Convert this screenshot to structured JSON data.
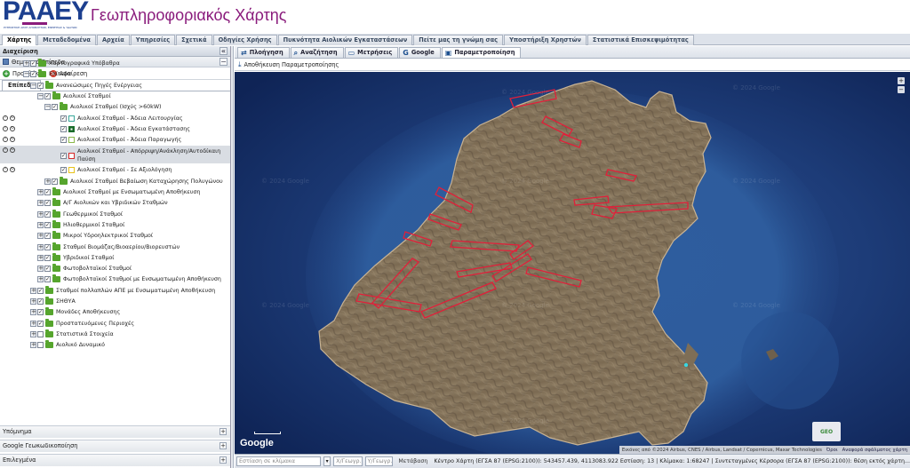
{
  "header": {
    "logo_text": "ΡΑΑΕΥ",
    "logo_subtitle": "ΡΥΘΜΙΣΤΙΚΗ ΑΡΧΗ ΑΠΟΒΛΗΤΩΝ, ΕΝΕΡΓΕΙΑΣ & ΥΔΑΤΩΝ",
    "app_title": "Γεωπληροφοριακός Χάρτης"
  },
  "main_tabs": [
    "Χάρτης",
    "Μεταδεδομένα",
    "Αρχεία",
    "Υπηρεσίες",
    "Σχετικά",
    "Οδηγίες Χρήσης",
    "Πυκνότητα Αιολικών Εγκαταστάσεων",
    "Πείτε μας τη γνώμη σας",
    "Υποστήριξη Χρηστών",
    "Στατιστικά Επισκεψιμότητας"
  ],
  "left_panel": {
    "title": "Διαχείριση",
    "section": "Θεματικά Επίπεδα",
    "add_label": "Προσθήκη",
    "remove_label": "Αφαίρεση",
    "tab": "Επίπεδα",
    "tree": [
      {
        "label": "Χαρτογραφικά Υπόβαθρα",
        "level": 2,
        "type": "folder",
        "checked": true,
        "exp": "+"
      },
      {
        "label": "Επίπεδα",
        "level": 2,
        "type": "folder",
        "checked": true,
        "exp": "−"
      },
      {
        "label": "Ανανεώσιμες Πηγές Ενέργειας",
        "level": 3,
        "type": "folder",
        "checked": true,
        "exp": "−"
      },
      {
        "label": "Αιολικοί Σταθμοί",
        "level": 4,
        "type": "folder",
        "checked": true,
        "exp": "−"
      },
      {
        "label": "Αιολικοί Σταθμοί (Ισχύς >60kW)",
        "level": 5,
        "type": "folder",
        "checked": true,
        "exp": "−"
      },
      {
        "label": "Αιολικοί Σταθμοί - Άδεια Λειτουργίας",
        "level": 6,
        "type": "layer",
        "checked": true,
        "legend": "#3aa89a",
        "info": true
      },
      {
        "label": "Αιολικοί Σταθμοί - Άδεια Εγκατάστασης",
        "level": 6,
        "type": "layer",
        "checked": true,
        "legend": "#1a6b2a",
        "legend_fill": true,
        "info": true
      },
      {
        "label": "Αιολικοί Σταθμοί - Άδεια Παραγωγής",
        "level": 6,
        "type": "layer",
        "checked": true,
        "legend": "#8ab84a",
        "info": true
      },
      {
        "label": "Αιολικοί Σταθμοί - Απόρριψη/Ανάκληση/Αυτοδίκαιη Παύση",
        "level": 6,
        "type": "layer",
        "checked": true,
        "legend": "#d62a2a",
        "info": true,
        "selected": true
      },
      {
        "label": "Αιολικοί Σταθμοί - Σε Αξιολόγηση",
        "level": 6,
        "type": "layer",
        "checked": true,
        "legend": "#e8c21a",
        "info": true
      },
      {
        "label": "Αιολικοί Σταθμοί Βεβαίωση Καταχώρησης Πολυγώνου",
        "level": 5,
        "type": "folder",
        "checked": true,
        "exp": "+"
      },
      {
        "label": "Αιολικοί Σταθμοί με Ενσωματωμένη Αποθήκευση",
        "level": 4,
        "type": "folder",
        "checked": true,
        "exp": "+"
      },
      {
        "label": "Α/Γ Αιολικών και Υβριδικών Σταθμών",
        "level": 4,
        "type": "folder",
        "checked": true,
        "exp": "+"
      },
      {
        "label": "Γεωθερμικοί Σταθμοί",
        "level": 4,
        "type": "folder",
        "checked": true,
        "exp": "+"
      },
      {
        "label": "Ηλιοθερμικοί Σταθμοί",
        "level": 4,
        "type": "folder",
        "checked": true,
        "exp": "+"
      },
      {
        "label": "Μικροί Υδροηλεκτρικοί Σταθμοί",
        "level": 4,
        "type": "folder",
        "checked": true,
        "exp": "+"
      },
      {
        "label": "Σταθμοί Βιομάζας/Βιοαερίου/Βιορευστών",
        "level": 4,
        "type": "folder",
        "checked": true,
        "exp": "+"
      },
      {
        "label": "Υβριδικοί Σταθμοί",
        "level": 4,
        "type": "folder",
        "checked": true,
        "exp": "+"
      },
      {
        "label": "Φωτοβολταϊκοί Σταθμοί",
        "level": 4,
        "type": "folder",
        "checked": true,
        "exp": "+"
      },
      {
        "label": "Φωτοβολταϊκοί Σταθμοί με Ενσωματωμένη Αποθήκευση",
        "level": 4,
        "type": "folder",
        "checked": true,
        "exp": "+"
      },
      {
        "label": "Σταθμοί πολλαπλών ΑΠΕ με Ενσωματωμένη Αποθήκευση",
        "level": 3,
        "type": "folder",
        "checked": true,
        "exp": "+"
      },
      {
        "label": "ΣΗΘΥΑ",
        "level": 3,
        "type": "folder",
        "checked": true,
        "exp": "+"
      },
      {
        "label": "Μονάδες Αποθήκευσης",
        "level": 3,
        "type": "folder",
        "checked": true,
        "exp": "+"
      },
      {
        "label": "Προστατευόμενες Περιοχές",
        "level": 3,
        "type": "folder",
        "checked": true,
        "exp": "+"
      },
      {
        "label": "Στατιστικά Στοιχεία",
        "level": 3,
        "type": "folder",
        "checked": false,
        "exp": "+"
      },
      {
        "label": "Αιολικό Δυναμικό",
        "level": 3,
        "type": "folder",
        "checked": false,
        "exp": "+"
      }
    ],
    "accordions": [
      "Υπόμνημα",
      "Google Γεωκωδικοποίηση",
      "Επιλεγμένα"
    ]
  },
  "map_toolbar": {
    "tabs": [
      {
        "label": "Πλοήγηση",
        "icon": "navigate-icon"
      },
      {
        "label": "Αναζήτηση",
        "icon": "search-icon"
      },
      {
        "label": "Μετρήσεις",
        "icon": "ruler-icon"
      },
      {
        "label": "Google",
        "icon": "google-icon"
      },
      {
        "label": "Παραμετροποίηση",
        "icon": "settings-icon"
      }
    ],
    "sub_action": "Αποθήκευση Παραμετροποίησης"
  },
  "map": {
    "watermark": "© 2024 Google",
    "google_mark": "Google",
    "attribution": "Εικόνες από ©2024 Airbus, CNES / Airbus, Landsat / Copernicus, Maxar Technologies",
    "terms": "Όροι",
    "report": "Αναφορά σφάλματος χάρτη",
    "overlay_color": "#e0203a",
    "geo_logo": "GEO"
  },
  "status_bar": {
    "scale_placeholder": "Εστίαση σε κλίμακα",
    "x_placeholder": "Χ/Γεωγρ.",
    "y_placeholder": "Υ/Γεωγρ.",
    "go_label": "Μετάβαση",
    "center_text": "Κέντρο Χάρτη (ΕΓΣΑ 87 (EPSG:2100)): 543457.439, 4113083.922 Εστίαση: 13 | Κλίμακα: 1:68247 | Συντεταγμένες Κέρσορα (ΕΓΣΑ 87 (EPSG:2100)): θέση εκτός χάρτη..."
  }
}
